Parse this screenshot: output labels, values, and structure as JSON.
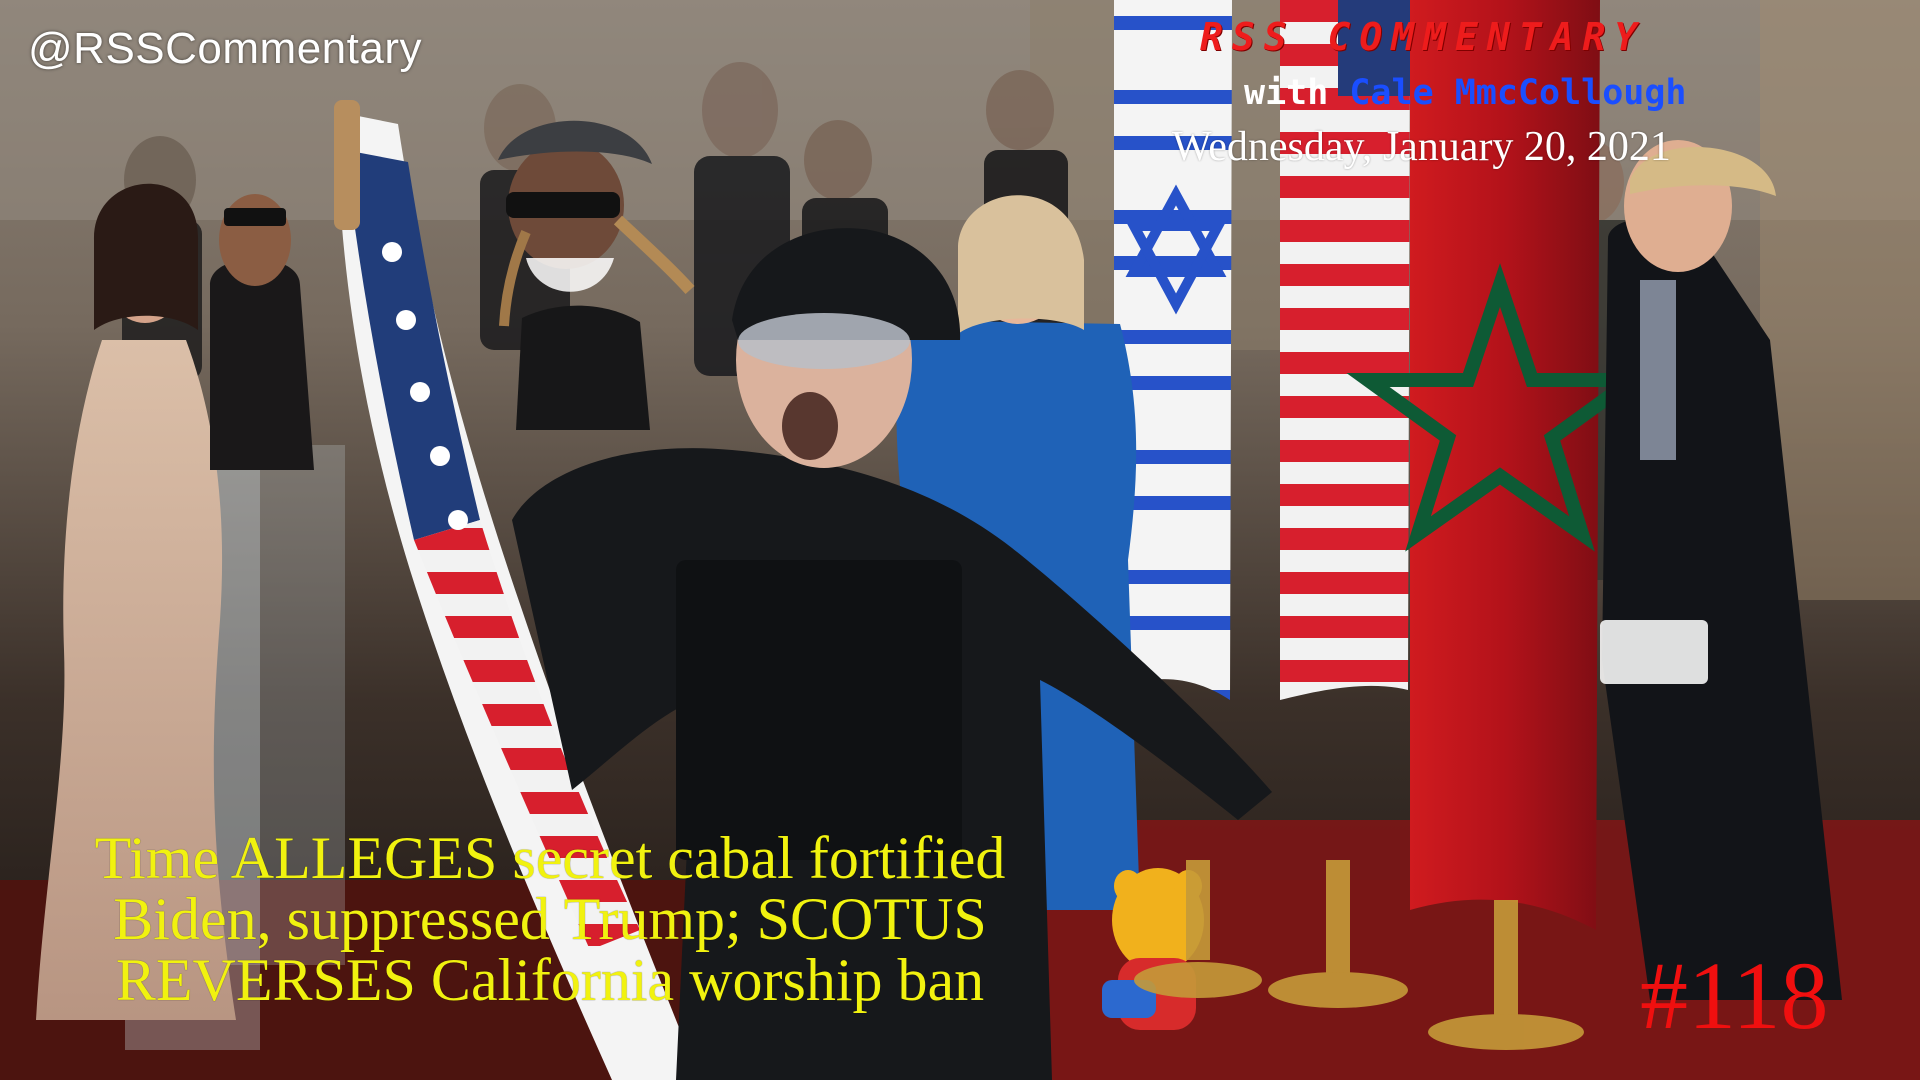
{
  "overlay": {
    "handle": "@RSSCommentary",
    "show_title": "RSS Commentary",
    "host_prefix": "with ",
    "host_name": "Cale MmcCollough",
    "date": "Wednesday, January 20, 2021",
    "headline": "Time ALLEGES secret cabal fortified\nBiden, suppressed Trump; SCOTUS\nREVERSES California worship ban",
    "episode_number": "#118"
  },
  "colors": {
    "title_red": "#ee1c1c",
    "host_blue": "#1a4eff",
    "headline_yellow": "#f1f20f",
    "episode_red": "#f00f0f"
  }
}
